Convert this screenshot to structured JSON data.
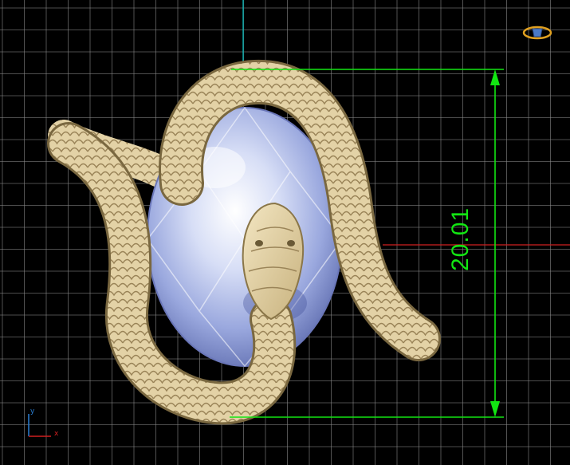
{
  "viewport": {
    "background": "#000000",
    "grid_color": "#8a8a8a",
    "axis_vertical_color": "#00c8c8",
    "axis_horizontal_color": "#d02020"
  },
  "dimension": {
    "value": "20.01",
    "color": "#12e612"
  },
  "axis_triad": {
    "y_label": "y",
    "x_label": "x",
    "y_color": "#2a7fd4",
    "x_color": "#d02020"
  },
  "view_cube": {
    "icon": "view-cube-icon",
    "ring_color": "#e0a020",
    "core_color": "#4a7ac8"
  },
  "model": {
    "metal_color": "#e3d2a6",
    "gem_color": "#c9d4f2"
  }
}
